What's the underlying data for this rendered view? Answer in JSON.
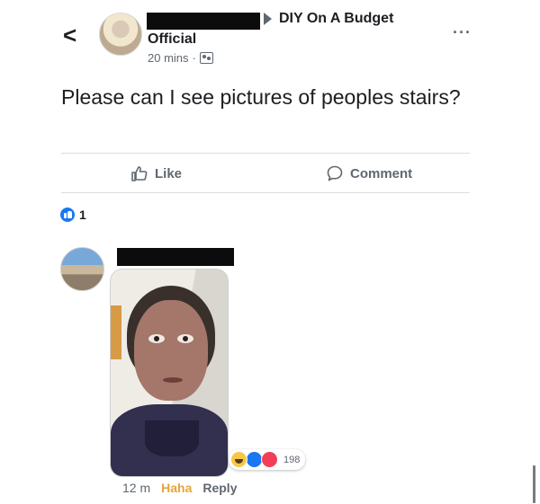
{
  "post": {
    "back_glyph": "<",
    "group_name": "DIY On A Budget",
    "author_role": "Official",
    "time": "20 mins",
    "separator": "·",
    "more_glyph": "···",
    "text": "Please can I see pictures of peoples stairs?"
  },
  "actions": {
    "like_label": "Like",
    "comment_label": "Comment"
  },
  "reaction_summary": {
    "count": "1"
  },
  "comment": {
    "reaction_count": "198",
    "time": "12 m",
    "reaction_label": "Haha",
    "reply_label": "Reply"
  },
  "colors": {
    "accent_blue": "#1877f2",
    "haha": "#e3a63a",
    "secondary_text": "#606770"
  }
}
